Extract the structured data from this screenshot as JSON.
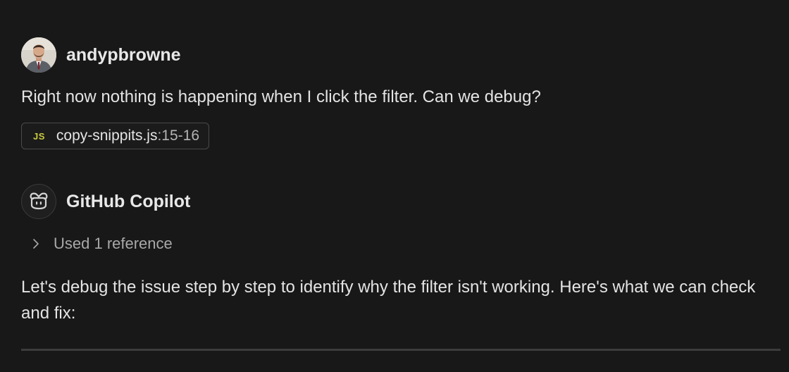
{
  "user_message": {
    "author": "andypbrowne",
    "text": "Right now nothing is happening when I click the filter. Can we debug?",
    "attachment": {
      "icon": "js-file-icon",
      "badge": "JS",
      "filename": "copy-snippits.js",
      "range": ":15-16"
    }
  },
  "assistant_message": {
    "author": "GitHub Copilot",
    "avatar_icon": "copilot-icon",
    "references_label": "Used 1 reference",
    "text": "Let's debug the issue step by step to identify why the filter isn't working. Here's what we can check and fix:"
  },
  "colors": {
    "background": "#181818",
    "js_badge": "#cbcb41",
    "muted_text": "#a8a8a8"
  }
}
